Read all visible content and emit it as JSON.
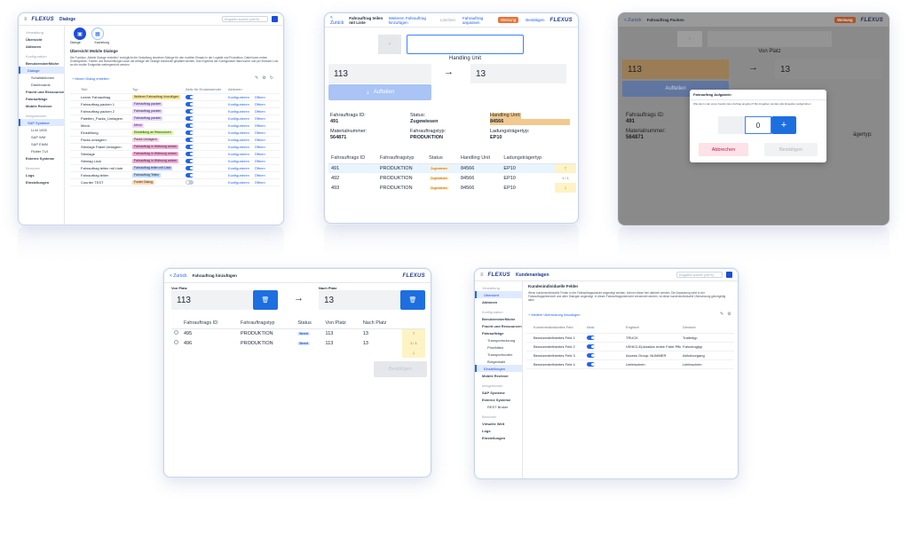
{
  "shot1": {
    "logo": "FLEXUS",
    "page_title": "Dialoge",
    "search_placeholder": "Eingaben suchen (ctrl+K)",
    "sidebar": [
      {
        "label": "Verwaltung",
        "kind": "sec"
      },
      {
        "label": "Übersicht",
        "kind": "b"
      },
      {
        "label": "Aktionen",
        "kind": "b"
      },
      {
        "label": "Konfiguration",
        "kind": "sec"
      },
      {
        "label": "Benutzeroberfläche",
        "kind": "b"
      },
      {
        "label": "Dialoge",
        "kind": "act"
      },
      {
        "label": "Schaltaktionen",
        "kind": "sub"
      },
      {
        "label": "Dashboards",
        "kind": "sub"
      },
      {
        "label": "Fracht und Ressourcen",
        "kind": "b"
      },
      {
        "label": "Fahraufträge",
        "kind": "b"
      },
      {
        "label": "Mobile Rechner",
        "kind": "b"
      },
      {
        "label": "Integrationen",
        "kind": "sec"
      },
      {
        "label": "SAP Systeme",
        "kind": "act"
      },
      {
        "label": "LLM 1000",
        "kind": "sub"
      },
      {
        "label": "SAP WM",
        "kind": "sub"
      },
      {
        "label": "SAP EWM",
        "kind": "sub"
      },
      {
        "label": "Flutter TUI",
        "kind": "sub"
      },
      {
        "label": "Externe Systeme",
        "kind": "b"
      },
      {
        "label": "Benutzer",
        "kind": "sec"
      },
      {
        "label": "Logs",
        "kind": "b"
      },
      {
        "label": "Einstellungen",
        "kind": "b"
      }
    ],
    "tabs": [
      "Dialoge",
      "Kachelung"
    ],
    "section_title": "Übersicht Mobile Dialoge",
    "description": "Die Funktion „Mobile Dialoge erstellen“ ermöglicht die Gestaltung einzelner Dialoge für den mobilen Einsatz in der Logistik und Produktion. Dabei kann neben Schrittgrößen, Farben und Beschriftungen auch die Abfolge der Dialoge individuell gestaltet werden. Das Ergebnis der Konfiguration lässt sicher und per Browser-Link an die mobile Endgeräte weitergereicht werden.",
    "add_link": "+ Neuen Dialog erstellen",
    "columns": [
      "Titel",
      "Typ",
      "Aktiv für Endanwender",
      "Aktionen"
    ],
    "rows": [
      {
        "title": "Leerer Fahrauftrag",
        "tag": "Weiterer Fahrauftrag hinzufügen",
        "tag_color": "#fde68a",
        "active": true
      },
      {
        "title": "Fahrauftrag packen 1",
        "tag": "Fahrauftrag packen",
        "tag_color": "#e9d5ff",
        "active": true
      },
      {
        "title": "Fahrauftrag packen 2",
        "tag": "Fahrauftrag packen",
        "tag_color": "#e9d5ff",
        "active": true
      },
      {
        "title": "Paletten_Packs_Umlagern",
        "tag": "Fahrauftrag packen",
        "tag_color": "#e9d5ff",
        "active": true
      },
      {
        "title": "Menü",
        "tag": "Menü",
        "tag_color": "#f5d0fe",
        "active": true
      },
      {
        "title": "Einstellung",
        "tag": "Einstellung an Ressourcen",
        "tag_color": "#d9f99d",
        "active": true
      },
      {
        "title": "Packs umlagern",
        "tag": "Packs Umlagern",
        "tag_color": "#fbcfe8",
        "active": true
      },
      {
        "title": "Stirnlage Paket Umlagern",
        "tag": "Fahrauftrag in Währung setzen",
        "tag_color": "#f9a8d4",
        "active": true
      },
      {
        "title": "Stirnlage",
        "tag": "Fahrauftrag in Währung setzen",
        "tag_color": "#f9a8d4",
        "active": true
      },
      {
        "title": "Stirnlag Lück",
        "tag": "Fahrauftrag in Währung setzen",
        "tag_color": "#f9a8d4",
        "active": true
      },
      {
        "title": "Fahrauftrag teilen mit Liste",
        "tag": "Fahrauftrag teilen mit Liste",
        "tag_color": "#c7d2fe",
        "active": true
      },
      {
        "title": "Fahrauftrag teilen",
        "tag": "Fahrauftrag Teilen",
        "tag_color": "#bfdbfe",
        "active": true
      },
      {
        "title": "Counter TEST",
        "tag": "Footer Dialog",
        "tag_color": "#fed7aa",
        "active": false
      }
    ],
    "action_config": "Konfigurieren",
    "action_open": "Öffnen"
  },
  "shot2": {
    "back": "< Zurück",
    "title": "Fahrauftrag teilen mit Liste",
    "actions": [
      "Weiteren Fahrauftrag hinzufügen",
      "Löschen",
      "Fahrauftrag anpassen"
    ],
    "badge": "Weisung",
    "actions2": "Bestätigen",
    "logo": "FLEXUS",
    "hu_label": "Handling Unit",
    "from": "113",
    "to": "13",
    "arrow": "→",
    "aufteilen": "Aufteilen",
    "info": [
      {
        "label": "Fahrauftrags ID:",
        "value": "491"
      },
      {
        "label": "Status:",
        "value": "Zugewiesen"
      },
      {
        "label": "Handling Unit:",
        "value": "84566"
      },
      {
        "label": "Materialnummer:",
        "value": "564871"
      },
      {
        "label": "Fahrauftragstyp:",
        "value": "PRODUKTION"
      },
      {
        "label": "Ladungsträgertyp:",
        "value": "EP10"
      }
    ],
    "columns": [
      "Fahrauftrags ID",
      "Fahrauftragstyp",
      "Status",
      "Handling Unit",
      "Ladungsträgertyp"
    ],
    "rows": [
      [
        "491",
        "PRODUKTION",
        "Zugewiesen",
        "84566",
        "EP10"
      ],
      [
        "492",
        "PRODUKTION",
        "Zugewiesen",
        "84566",
        "EP10"
      ],
      [
        "493",
        "PRODUKTION",
        "Zugewiesen",
        "84566",
        "EP10"
      ]
    ],
    "pager": "1 / 1"
  },
  "shot3": {
    "back": "< Zurück",
    "title": "Fahrauftrag Packen",
    "badge": "Weisung",
    "logo": "FLEXUS",
    "von_platz": "Von Platz",
    "from": "113",
    "to": "13",
    "arrow": "→",
    "aufteilen": "Aufteilen",
    "info": [
      {
        "label": "Fahrauftrags ID:",
        "value": "491"
      },
      {
        "label": "Materialnummer:",
        "value": "564871"
      }
    ],
    "info_right": "ägertyp:",
    "modal_title": "Fahrauftrag Aufgabeln",
    "modal_text": "Wie kann man einen bestimmten Auftrag angeben? Bei Angaben werden alle Eingaben aufgehoben",
    "qty": "0",
    "plus": "+",
    "cancel": "Abbrechen",
    "confirm": "Bestätigen"
  },
  "shot4": {
    "back": "< Zurück",
    "title": "Fahrauftrag hinzufügen",
    "logo": "FLEXUS",
    "von_label": "Von Platz",
    "nach_label": "Nach Platz",
    "from": "113",
    "to": "13",
    "arrow": "→",
    "columns": [
      "Fahrauftrags ID",
      "Fahrauftragstyp",
      "Status",
      "Von Platz",
      "Nach Platz"
    ],
    "rows": [
      [
        "495",
        "PRODUKTION",
        "Bereit",
        "113",
        "13"
      ],
      [
        "496",
        "PRODUKTION",
        "Bereit",
        "113",
        "13"
      ]
    ],
    "pager": "1 / 1",
    "confirm": "Bestätigen"
  },
  "shot5": {
    "logo": "FLEXUS",
    "page_title": "Kundenanlagen",
    "search_placeholder": "Eingaben suchen (ctrl+K)",
    "sidebar": [
      {
        "label": "Verwaltung",
        "kind": "sec"
      },
      {
        "label": "Übersicht",
        "kind": "act"
      },
      {
        "label": "Aktionen",
        "kind": "b"
      },
      {
        "label": "Konfiguration",
        "kind": "sec"
      },
      {
        "label": "Benutzeroberfläche",
        "kind": "b"
      },
      {
        "label": "Fracht und Ressourcen",
        "kind": "b"
      },
      {
        "label": "Fahraufträge",
        "kind": "b"
      },
      {
        "label": "Transportnutzung",
        "kind": "sub"
      },
      {
        "label": "Prioritäten",
        "kind": "sub"
      },
      {
        "label": "Transportrouten",
        "kind": "sub"
      },
      {
        "label": "Bürgerwahl",
        "kind": "sub"
      },
      {
        "label": "Einstellungen",
        "kind": "act"
      },
      {
        "label": "Mobile Rechner",
        "kind": "b"
      },
      {
        "label": "Integrationen",
        "kind": "sec"
      },
      {
        "label": "SAP Systeme",
        "kind": "b"
      },
      {
        "label": "Externe Systeme",
        "kind": "b"
      },
      {
        "label": "REST Broker",
        "kind": "sub"
      },
      {
        "label": "Benutzer",
        "kind": "sec"
      },
      {
        "label": "Virtuelle Welt",
        "kind": "b"
      },
      {
        "label": "Logs",
        "kind": "b"
      },
      {
        "label": "Einstellungen",
        "kind": "b"
      }
    ],
    "section_title": "Kundenindividuelle Felder",
    "description": "Wenn kundenindividuelle Felder in der Fahrauftragsansicht angezeigt werden, können diese hier aktiviert werden. Die Anpassung wirkt in der Fahrauftragsübersicht und allen Dialogen angezeigt. In dieser Fahrauftragsübersicht verwendet werden, ist diese kundenindividuelle Übersetzung gleichgültig aktiv.",
    "add_link": "+ Weitere Übersetzung hinzufügen",
    "columns": [
      "Kundenindividuelles Feld",
      "Aktiv",
      "Englisch",
      "Deutsch"
    ],
    "rows": [
      {
        "field": "Benutzerdefiniertes Feld 1",
        "active": true,
        "en": "TRUCK",
        "de": "Trailertyp"
      },
      {
        "field": "Benutzerdefiniertes Feld 2",
        "active": true,
        "en": "VEHICLE(duration entire Fahrt Pfliche...)",
        "de": "Fahrzeugtyp"
      },
      {
        "field": "Benutzerdefiniertes Feld 3",
        "active": true,
        "en": "Access Group: NUMMER",
        "de": "Abholvorgang"
      },
      {
        "field": "Benutzerdefiniertes Feld 4",
        "active": true,
        "en": "Lieferschein",
        "de": "Lieferschein"
      }
    ]
  }
}
